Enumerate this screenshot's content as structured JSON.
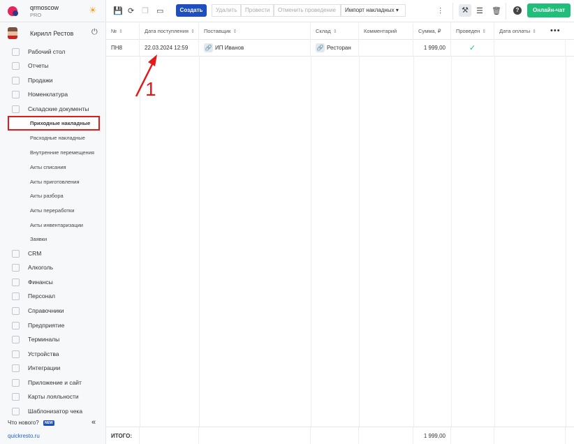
{
  "brand": {
    "name": "qrmoscow",
    "plan": "PRO"
  },
  "user": {
    "name": "Кирилл Рестов"
  },
  "sidebar": {
    "items": [
      {
        "label": "Рабочий стол",
        "icon": "dashboard-icon"
      },
      {
        "label": "Отчеты",
        "icon": "reports-icon"
      },
      {
        "label": "Продажи",
        "icon": "sales-icon"
      },
      {
        "label": "Номенклатура",
        "icon": "tag-icon"
      },
      {
        "label": "Складские документы",
        "icon": "warehouse-icon"
      }
    ],
    "sub_items": [
      "Приходные накладные",
      "Расходные накладные",
      "Внутренние перемещения",
      "Акты списания",
      "Акты приготовления",
      "Акты разбора",
      "Акты переработки",
      "Акты инвентаризации",
      "Заявки"
    ],
    "active_sub": "Приходные накладные",
    "lower_items": [
      {
        "label": "CRM",
        "icon": "crm-icon"
      },
      {
        "label": "Алкоголь",
        "icon": "glass-icon"
      },
      {
        "label": "Финансы",
        "icon": "wallet-icon"
      },
      {
        "label": "Персонал",
        "icon": "person-icon"
      },
      {
        "label": "Справочники",
        "icon": "book-icon"
      },
      {
        "label": "Предприятие",
        "icon": "building-icon"
      },
      {
        "label": "Терминалы",
        "icon": "terminal-icon"
      },
      {
        "label": "Устройства",
        "icon": "device-icon"
      },
      {
        "label": "Интеграции",
        "icon": "integration-icon"
      },
      {
        "label": "Приложение и сайт",
        "icon": "app-icon"
      },
      {
        "label": "Карты лояльности",
        "icon": "card-icon"
      },
      {
        "label": "Шаблонизатор чека",
        "icon": "receipt-icon"
      }
    ],
    "whats_new": "Что нового?",
    "new_badge": "NEW",
    "footer_link": "quickresto.ru"
  },
  "toolbar": {
    "create": "Создать",
    "delete": "Удалить",
    "post": "Провести",
    "unpost": "Отменить проведение",
    "import": "Импорт накладных",
    "chat": "Онлайн-чат"
  },
  "table": {
    "columns": [
      "№",
      "Дата поступления",
      "Поставщик",
      "Склад",
      "Комментарий",
      "Сумма, ₽",
      "Проведен",
      "Дата оплаты"
    ],
    "rows": [
      {
        "num": "ПН8",
        "date": "22.03.2024 12:59",
        "supplier": "ИП Иванов",
        "warehouse": "Ресторан",
        "comment": "",
        "sum": "1 999,00",
        "posted": "✓",
        "pay_date": ""
      }
    ],
    "footer": {
      "label": "ИТОГО:",
      "sum": "1 999,00"
    }
  },
  "annotation": {
    "label": "1",
    "color": "#e21a1a"
  },
  "colors": {
    "primary": "#1f4fbf",
    "chat": "#1fbf7a",
    "highlight": "#e21a1a"
  }
}
